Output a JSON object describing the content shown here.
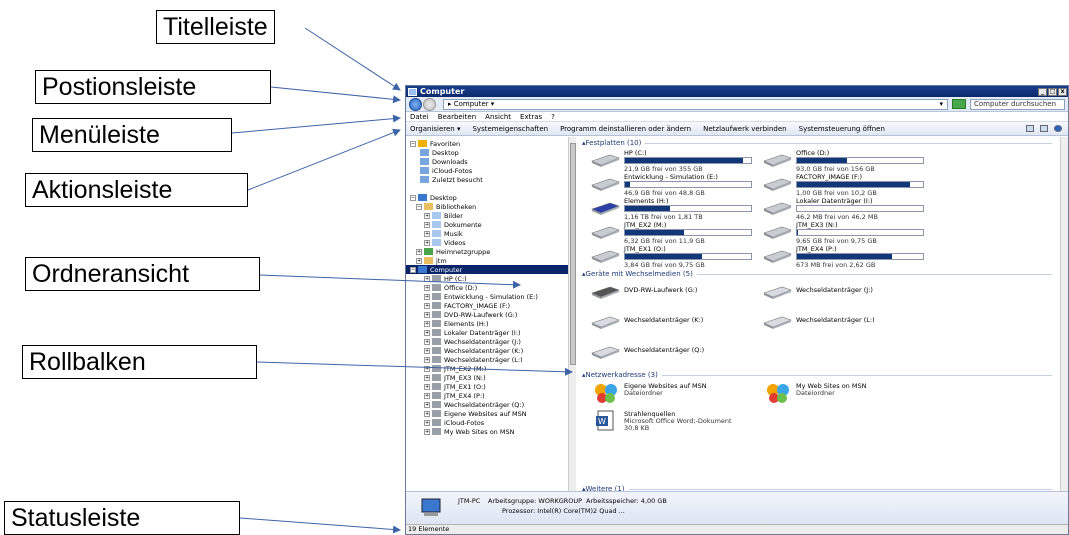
{
  "annotations": {
    "title_bar": "Titelleiste",
    "position_bar": "Postionsleiste",
    "menu_bar": "Menüleiste",
    "action_bar": "Aktionsleiste",
    "folder_view": "Ordneransicht",
    "scrollbar": "Rollbalken",
    "status_bar": "Statusleiste"
  },
  "window": {
    "title": "Computer",
    "controls": [
      "_",
      "□",
      "x"
    ],
    "address": "Computer",
    "search_placeholder": "Computer durchsuchen"
  },
  "menu": [
    "Datei",
    "Bearbeiten",
    "Ansicht",
    "Extras",
    "?"
  ],
  "actions": [
    "Organisieren ▾",
    "Systemeigenschaften",
    "Programm deinstallieren oder ändern",
    "Netzlaufwerk verbinden",
    "Systemsteuerung öffnen"
  ],
  "nav": {
    "favorites": [
      "Favoriten",
      "Desktop",
      "Downloads",
      "iCloud-Fotos",
      "Zuletzt besucht"
    ],
    "desktop": "Desktop",
    "libraries": "Bibliotheken",
    "library_items": [
      "Bilder",
      "Dokumente",
      "Musik",
      "Videos"
    ],
    "homegroup": "Heimnetzgruppe",
    "user": "jtm",
    "computer": "Computer",
    "computer_items": [
      "HP (C:)",
      "Office (D:)",
      "Entwicklung - Simulation (E:)",
      "FACTORY_IMAGE (F:)",
      "DVD-RW-Laufwerk (G:)",
      "Elements (H:)",
      "Lokaler Datenträger (I:)",
      "Wechseldatenträger (J:)",
      "Wechseldatenträger (K:)",
      "Wechseldatenträger (L:)",
      "JTM_EX2 (M:)",
      "JTM_EX3 (N:)",
      "JTM_EX1 (O:)",
      "JTM_EX4 (P:)",
      "Wechseldatenträger (Q:)",
      "Eigene Websites auf MSN",
      "iCloud-Fotos",
      "My Web Sites on MSN"
    ]
  },
  "groups": {
    "drives": "Festplatten (10)",
    "removable": "Geräte mit Wechselmedien (5)",
    "network": "Netzwerkadresse (3)",
    "more": "Weitere (1)"
  },
  "drives": [
    {
      "name": "HP (C:)",
      "free": "21,9 GB frei von 355 GB",
      "used": 0.94
    },
    {
      "name": "Office (D:)",
      "free": "93,0 GB frei von 156 GB",
      "used": 0.4
    },
    {
      "name": "Entwicklung - Simulation (E:)",
      "free": "46,9 GB frei von 48,8 GB",
      "used": 0.04
    },
    {
      "name": "FACTORY_IMAGE (F:)",
      "free": "1,00 GB frei von 10,2 GB",
      "used": 0.9
    },
    {
      "name": "Elements (H:)",
      "free": "1,16 TB frei von 1,81 TB",
      "used": 0.36
    },
    {
      "name": "Lokaler Datenträger (I:)",
      "free": "46,2 MB frei von 46,2 MB",
      "used": 0.0
    },
    {
      "name": "JTM_EX2 (M:)",
      "free": "6,32 GB frei von 11,9 GB",
      "used": 0.47
    },
    {
      "name": "JTM_EX3 (N:)",
      "free": "9,65 GB frei von 9,75 GB",
      "used": 0.01
    },
    {
      "name": "JTM_EX1 (O:)",
      "free": "3,84 GB frei von 9,75 GB",
      "used": 0.61
    },
    {
      "name": "JTM_EX4 (P:)",
      "free": "673 MB frei von 2,62 GB",
      "used": 0.75
    }
  ],
  "removable": [
    "DVD-RW-Laufwerk (G:)",
    "Wechseldatenträger (J:)",
    "Wechseldatenträger (K:)",
    "Wechseldatenträger (L:)",
    "Wechseldatenträger (Q:)"
  ],
  "network": [
    {
      "name": "Eigene Websites auf MSN",
      "type": "Dateiordner"
    },
    {
      "name": "My Web Sites on MSN",
      "type": "Dateiordner"
    },
    {
      "name": "Strahlenquellen",
      "type": "Microsoft Office Word;-Dokument",
      "size": "30,8 KB"
    }
  ],
  "details": {
    "pc": "JTM-PC",
    "workgroup": "Arbeitsgruppe: WORKGROUP",
    "memory": "Arbeitsspeicher: 4,00 GB",
    "cpu": "Prozessor: Intel(R) Core(TM)2 Quad ..."
  },
  "status": "19 Elemente",
  "colors": {
    "titlebar": "#0c2a6b",
    "selection": "#0a246a",
    "bar_fill": "#123779"
  }
}
